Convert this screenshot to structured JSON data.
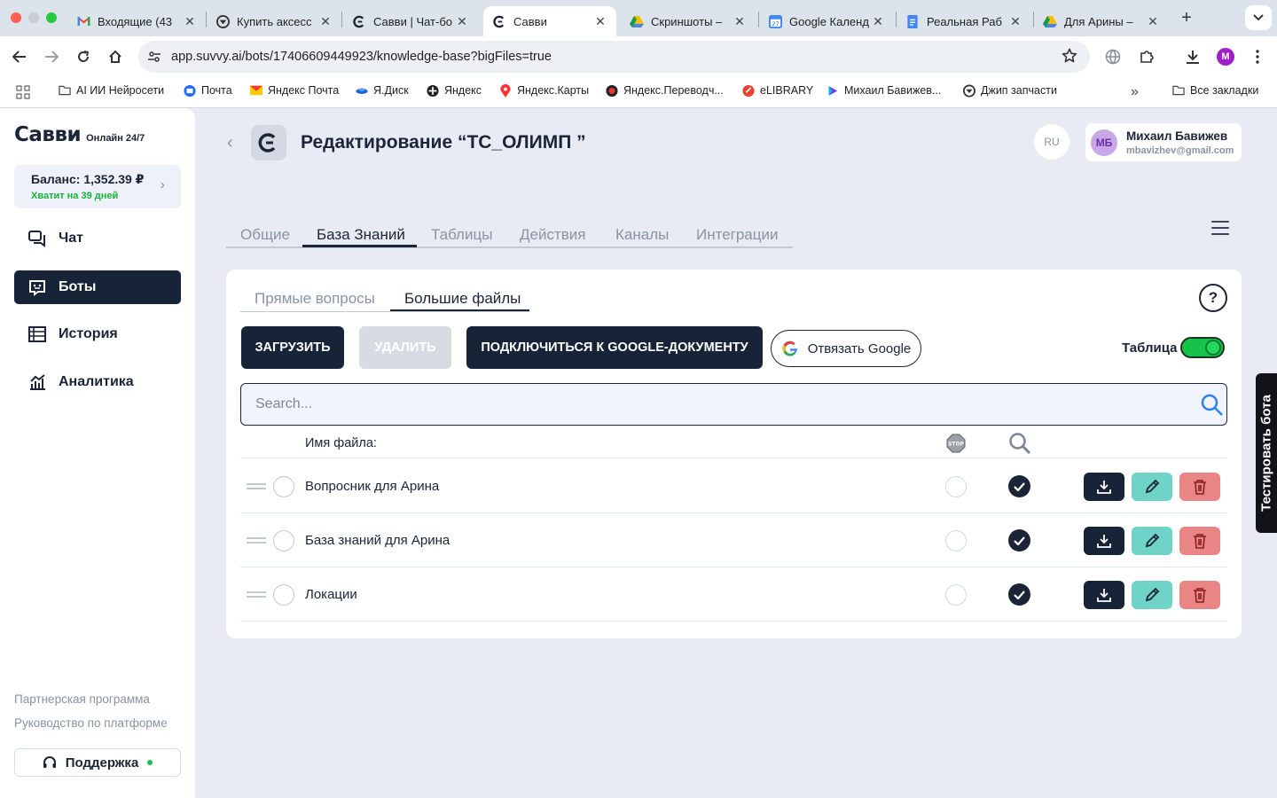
{
  "browser": {
    "tabs": [
      {
        "label": "Входящие (43",
        "icon": "gmail-icon"
      },
      {
        "label": "Купить аксесс",
        "icon": "jeep-icon"
      },
      {
        "label": "Савви | Чат-бо",
        "icon": "suvvy-icon"
      },
      {
        "label": "Савви",
        "icon": "suvvy-icon",
        "active": true
      },
      {
        "label": "Скриншоты – ",
        "icon": "drive-icon"
      },
      {
        "label": "Google Календ",
        "icon": "calendar-icon"
      },
      {
        "label": "Реальная Раб",
        "icon": "docs-icon"
      },
      {
        "label": "Для Арины – ",
        "icon": "drive-icon"
      }
    ],
    "url": "app.suvvy.ai/bots/17406609449923/knowledge-base?bigFiles=true",
    "profile_initial": "M",
    "bookmarks": [
      {
        "label": "AI ИИ Нейросети",
        "icon": "folder-icon"
      },
      {
        "label": "Почта",
        "icon": "mail-icon"
      },
      {
        "label": "Яндекс Почта",
        "icon": "yandex-mail-icon"
      },
      {
        "label": "Я.Диск",
        "icon": "yandex-disk-icon"
      },
      {
        "label": "Яндекс",
        "icon": "yandex-icon"
      },
      {
        "label": "Яндекс.Карты",
        "icon": "map-pin-icon"
      },
      {
        "label": "Яндекс.Переводч...",
        "icon": "translate-icon"
      },
      {
        "label": "eLIBRARY",
        "icon": "elibrary-icon"
      },
      {
        "label": "Михаил Бавижев...",
        "icon": "video-icon"
      },
      {
        "label": "Джип запчасти",
        "icon": "jeep-icon"
      }
    ],
    "all_bookmarks": "Все закладки"
  },
  "sidebar": {
    "brand": "Савви",
    "online": "Онлайн 24/7",
    "balance": "Баланс: 1,352.39 ₽",
    "balance_note": "Хватит на 39 дней",
    "nav": [
      {
        "label": "Чат",
        "icon": "chat-icon"
      },
      {
        "label": "Боты",
        "icon": "bot-icon",
        "active": true
      },
      {
        "label": "История",
        "icon": "history-icon"
      },
      {
        "label": "Аналитика",
        "icon": "analytics-icon"
      }
    ],
    "links": [
      "Партнерская программа",
      "Руководство по платформе"
    ],
    "support": "Поддержка"
  },
  "header": {
    "title": "Редактирование “ТС_ОЛИМП ”",
    "lang": "RU",
    "user": {
      "initials": "МБ",
      "name": "Михаил Бавижев",
      "email": "mbavizhev@gmail.com"
    }
  },
  "main_tabs": [
    "Общие",
    "База Знаний",
    "Таблицы",
    "Действия",
    "Каналы",
    "Интеграции"
  ],
  "main_tab_active": "База Знаний",
  "sub_tabs": [
    "Прямые вопросы",
    "Большие файлы"
  ],
  "sub_tab_active": "Большие файлы",
  "actions": {
    "upload": "ЗАГРУЗИТЬ",
    "delete": "УДАЛИТЬ",
    "connect_google": "ПОДКЛЮЧИТЬСЯ К GOOGLE-ДОКУМЕНТУ",
    "unlink_google": "Отвязать Google",
    "table_toggle_label": "Таблица",
    "table_toggle_on": true
  },
  "search": {
    "placeholder": "Search...",
    "value": ""
  },
  "table": {
    "header_name": "Имя файла:",
    "stop_label": "STOP",
    "rows": [
      {
        "name": "Вопросник для Арина",
        "stop": false,
        "search": true
      },
      {
        "name": "База знаний для Арина",
        "stop": false,
        "search": true
      },
      {
        "name": "Локации",
        "stop": false,
        "search": true
      }
    ]
  },
  "test_bot": "Тестировать бота",
  "colors": {
    "accent": "#172337",
    "success": "#17c24a",
    "edit": "#6fd3c8",
    "delete": "#ea8585"
  }
}
